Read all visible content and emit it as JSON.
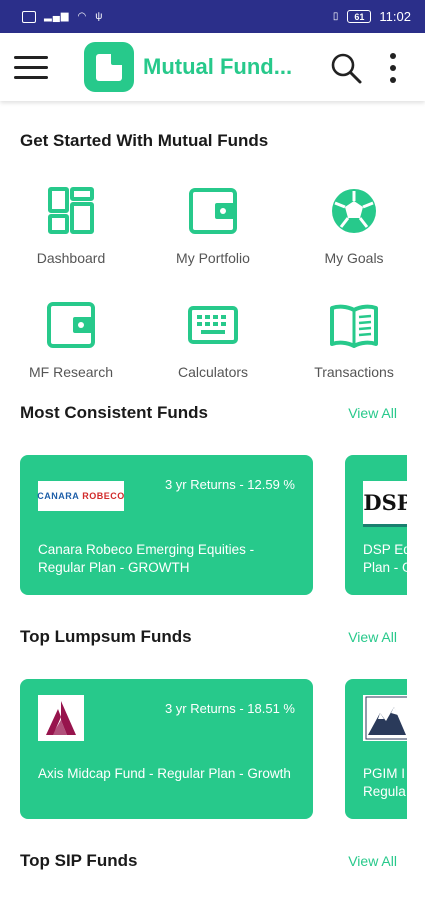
{
  "status_bar": {
    "time": "11:02",
    "battery": "61"
  },
  "app_bar": {
    "title": "Mutual Fund..."
  },
  "get_started": {
    "title": "Get Started With Mutual Funds",
    "items": [
      {
        "label": "Dashboard",
        "icon": "dashboard-icon"
      },
      {
        "label": "My Portfolio",
        "icon": "wallet-icon"
      },
      {
        "label": "My Goals",
        "icon": "football-icon"
      },
      {
        "label": "MF Research",
        "icon": "wallet-research-icon"
      },
      {
        "label": "Calculators",
        "icon": "keyboard-icon"
      },
      {
        "label": "Transactions",
        "icon": "book-icon"
      }
    ]
  },
  "sections": [
    {
      "title": "Most Consistent Funds",
      "view_all": "View All",
      "cards": [
        {
          "returns": "3 yr Returns - 12.59 %",
          "name": "Canara Robeco Emerging Equities - Regular Plan - GROWTH",
          "logo_text": "CANARA",
          "logo_text2": "ROBECO"
        },
        {
          "name": "DSP Eq... Plan - G...",
          "name_line1": "DSP Eq",
          "name_line2": "Plan - G",
          "logo_text": "DSP"
        }
      ]
    },
    {
      "title": "Top Lumpsum Funds",
      "view_all": "View All",
      "cards": [
        {
          "returns": "3 yr Returns - 18.51 %",
          "name": "Axis Midcap Fund - Regular Plan - Growth"
        },
        {
          "name_line1": "PGIM I",
          "name_line2": "Regula"
        }
      ]
    },
    {
      "title": "Top SIP Funds",
      "view_all": "View All"
    }
  ],
  "colors": {
    "accent": "#27c98b",
    "status_bar": "#2b2f8a"
  }
}
